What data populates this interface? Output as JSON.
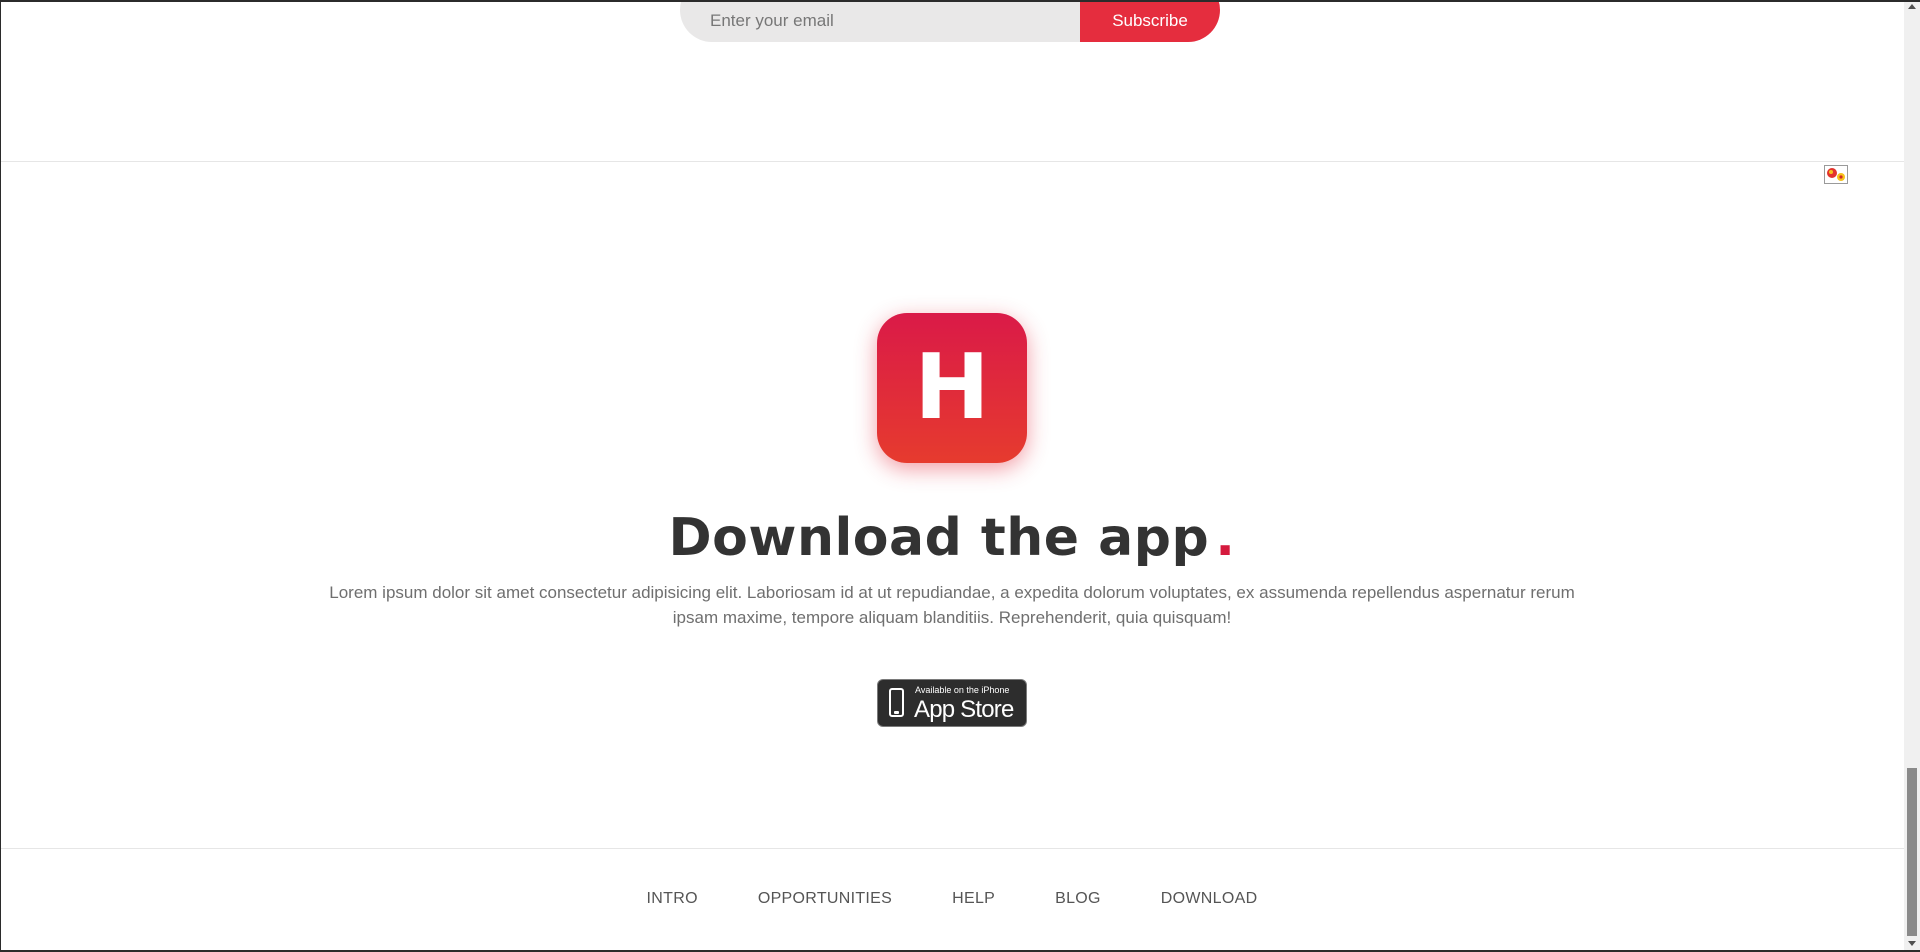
{
  "newsletter": {
    "email_placeholder": "Enter your email",
    "subscribe_label": "Subscribe"
  },
  "download": {
    "logo_letter": "H",
    "title": "Download the app",
    "title_dot": ".",
    "description": "Lorem ipsum dolor sit amet consectetur adipisicing elit. Laboriosam id at ut repudiandae, a expedita dolorum voluptates, ex assumenda repellendus aspernatur rerum ipsam maxime, tempore aliquam blanditiis. Reprehenderit, quia quisquam!",
    "badge_small": "Available on the iPhone",
    "badge_large": "App Store"
  },
  "footer": {
    "nav": [
      "INTRO",
      "OPPORTUNITIES",
      "HELP",
      "BLOG",
      "DOWNLOAD"
    ]
  },
  "colors": {
    "accent": "#e52d3e",
    "logo_top": "#da1a48",
    "logo_bottom": "#e63b2e",
    "heading": "#333333",
    "body_text": "#6f6f6f"
  },
  "icons": [
    "phone-icon",
    "widget-icon"
  ]
}
